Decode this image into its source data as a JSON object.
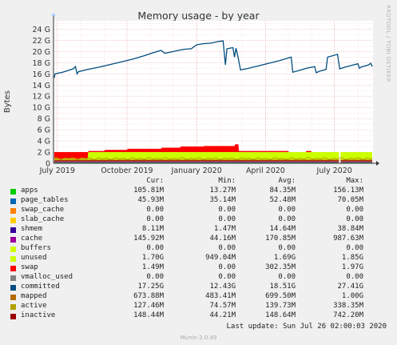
{
  "title": "Memory usage - by year",
  "side_credit": "RRDTOOL / TOBI OETIKER",
  "footer": {
    "last_update": "Last update: Sun Jul 26 02:00:03 2020",
    "version": "Munin 2.0.49"
  },
  "chart_data": {
    "type": "area",
    "title": "Memory usage - by year",
    "ylabel": "Bytes",
    "xlabel": "",
    "ylim": [
      0,
      25.5
    ],
    "y_unit": "G",
    "yticks": [
      "0",
      "2 G",
      "4 G",
      "6 G",
      "8 G",
      "10 G",
      "12 G",
      "14 G",
      "16 G",
      "18 G",
      "20 G",
      "22 G",
      "24 G"
    ],
    "xticks": [
      "July 2019",
      "October 2019",
      "January 2020",
      "April 2020",
      "July 2020"
    ],
    "grid": true,
    "legend_position": "bottom",
    "committed_series": [
      [
        "2019-06-27",
        15.3
      ],
      [
        "2019-06-28",
        16.0
      ],
      [
        "2019-07-01",
        16.1
      ],
      [
        "2019-07-08",
        16.3
      ],
      [
        "2019-07-15",
        16.6
      ],
      [
        "2019-07-22",
        16.9
      ],
      [
        "2019-07-25",
        17.3
      ],
      [
        "2019-07-27",
        16.0
      ],
      [
        "2019-07-29",
        16.4
      ],
      [
        "2019-08-10",
        16.8
      ],
      [
        "2019-08-25",
        17.2
      ],
      [
        "2019-09-10",
        17.7
      ],
      [
        "2019-09-25",
        18.2
      ],
      [
        "2019-10-10",
        18.7
      ],
      [
        "2019-10-25",
        19.3
      ],
      [
        "2019-11-05",
        19.8
      ],
      [
        "2019-11-15",
        20.2
      ],
      [
        "2019-11-20",
        19.7
      ],
      [
        "2019-12-01",
        20.0
      ],
      [
        "2019-12-15",
        20.4
      ],
      [
        "2019-12-25",
        20.5
      ],
      [
        "2020-01-01",
        21.2
      ],
      [
        "2020-01-10",
        21.4
      ],
      [
        "2020-01-20",
        21.5
      ],
      [
        "2020-01-30",
        21.8
      ],
      [
        "2020-02-05",
        21.9
      ],
      [
        "2020-02-08",
        17.6
      ],
      [
        "2020-02-10",
        20.5
      ],
      [
        "2020-02-18",
        20.7
      ],
      [
        "2020-02-20",
        19.0
      ],
      [
        "2020-02-22",
        20.6
      ],
      [
        "2020-02-25",
        18.8
      ],
      [
        "2020-02-28",
        16.7
      ],
      [
        "2020-03-10",
        17.0
      ],
      [
        "2020-03-25",
        17.5
      ],
      [
        "2020-04-05",
        17.9
      ],
      [
        "2020-04-20",
        18.4
      ],
      [
        "2020-04-30",
        18.8
      ],
      [
        "2020-05-05",
        19.0
      ],
      [
        "2020-05-07",
        16.3
      ],
      [
        "2020-05-15",
        16.6
      ],
      [
        "2020-05-25",
        17.0
      ],
      [
        "2020-06-05",
        17.3
      ],
      [
        "2020-06-07",
        16.2
      ],
      [
        "2020-06-12",
        16.5
      ],
      [
        "2020-06-20",
        16.8
      ],
      [
        "2020-06-22",
        19.0
      ],
      [
        "2020-07-05",
        19.5
      ],
      [
        "2020-07-08",
        16.9
      ],
      [
        "2020-07-15",
        17.2
      ],
      [
        "2020-07-26",
        17.6
      ],
      [
        "2020-08-01",
        17.8
      ],
      [
        "2020-08-03",
        17.0
      ],
      [
        "2020-08-05",
        17.2
      ],
      [
        "2020-08-10",
        17.4
      ],
      [
        "2020-08-15",
        17.6
      ],
      [
        "2020-08-18",
        17.9
      ],
      [
        "2020-08-20",
        17.3
      ]
    ],
    "swap_stack_top_series": [
      [
        "2019-06-27",
        0.8
      ],
      [
        "2019-08-10",
        0.8
      ],
      [
        "2019-08-11",
        2.2
      ],
      [
        "2019-09-01",
        2.2
      ],
      [
        "2019-09-02",
        2.4
      ],
      [
        "2019-10-01",
        2.4
      ],
      [
        "2019-10-02",
        2.6
      ],
      [
        "2019-11-15",
        2.6
      ],
      [
        "2019-11-16",
        2.8
      ],
      [
        "2019-12-10",
        2.8
      ],
      [
        "2019-12-11",
        3.0
      ],
      [
        "2020-01-10",
        3.0
      ],
      [
        "2020-01-11",
        3.1
      ],
      [
        "2020-02-20",
        3.1
      ],
      [
        "2020-02-21",
        3.4
      ],
      [
        "2020-02-25",
        3.4
      ],
      [
        "2020-02-26",
        2.2
      ],
      [
        "2020-05-01",
        2.2
      ],
      [
        "2020-05-02",
        2.0
      ],
      [
        "2020-05-24",
        2.0
      ],
      [
        "2020-05-25",
        2.2
      ],
      [
        "2020-05-31",
        2.2
      ],
      [
        "2020-06-01",
        2.0
      ],
      [
        "2020-08-20",
        2.0
      ]
    ],
    "unused_top": 2.0,
    "legend_headers": [
      "Cur:",
      "Min:",
      "Avg:",
      "Max:"
    ],
    "series": [
      {
        "name": "apps",
        "color": "#00cc00",
        "cur": "105.81M",
        "min": "13.27M",
        "avg": "84.35M",
        "max": "156.13M"
      },
      {
        "name": "page_tables",
        "color": "#0066b3",
        "cur": "45.93M",
        "min": "35.14M",
        "avg": "52.48M",
        "max": "70.05M"
      },
      {
        "name": "swap_cache",
        "color": "#ff8000",
        "cur": "0.00",
        "min": "0.00",
        "avg": "0.00",
        "max": "0.00"
      },
      {
        "name": "slab_cache",
        "color": "#ffcc00",
        "cur": "0.00",
        "min": "0.00",
        "avg": "0.00",
        "max": "0.00"
      },
      {
        "name": "shmem",
        "color": "#330099",
        "cur": "8.11M",
        "min": "1.47M",
        "avg": "14.64M",
        "max": "38.84M"
      },
      {
        "name": "cache",
        "color": "#990099",
        "cur": "145.92M",
        "min": "44.16M",
        "avg": "170.85M",
        "max": "987.63M"
      },
      {
        "name": "buffers",
        "color": "#ccff00",
        "cur": "0.00",
        "min": "0.00",
        "avg": "0.00",
        "max": "0.00"
      },
      {
        "name": "unused",
        "color": "#ccff00",
        "cur": "1.70G",
        "min": "949.04M",
        "avg": "1.69G",
        "max": "1.85G"
      },
      {
        "name": "swap",
        "color": "#ff0000",
        "cur": "1.49M",
        "min": "0.00",
        "avg": "302.35M",
        "max": "1.97G"
      },
      {
        "name": "vmalloc_used",
        "color": "#808080",
        "cur": "0.00",
        "min": "0.00",
        "avg": "0.00",
        "max": "0.00"
      },
      {
        "name": "committed",
        "color": "#004d80",
        "cur": "17.25G",
        "min": "12.43G",
        "avg": "18.51G",
        "max": "27.41G"
      },
      {
        "name": "mapped",
        "color": "#b36b00",
        "cur": "673.88M",
        "min": "483.41M",
        "avg": "699.50M",
        "max": "1.00G"
      },
      {
        "name": "active",
        "color": "#b3a000",
        "cur": "127.46M",
        "min": "74.57M",
        "avg": "139.73M",
        "max": "338.35M"
      },
      {
        "name": "inactive",
        "color": "#990000",
        "cur": "148.44M",
        "min": "44.21M",
        "avg": "148.64M",
        "max": "742.20M"
      }
    ]
  }
}
